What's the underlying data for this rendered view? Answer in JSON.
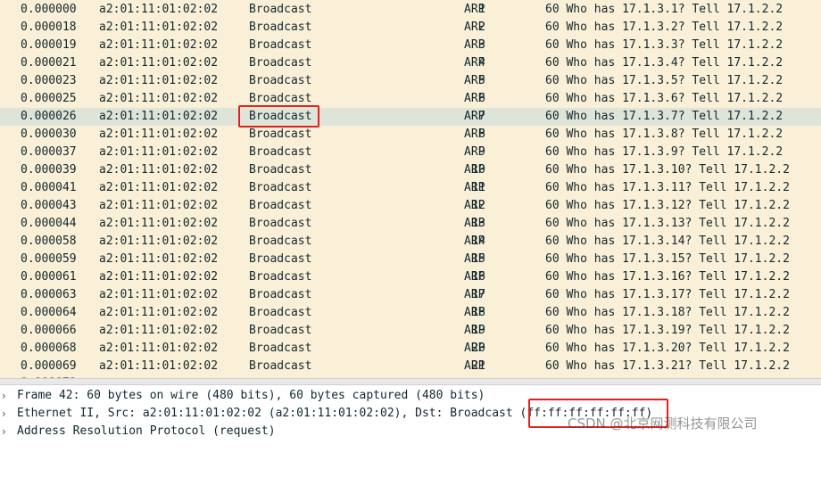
{
  "packet_list": {
    "rows": [
      {
        "time": "0.000000",
        "source": "a2:01:11:01:02:02",
        "destination": "Broadcast",
        "no": "1",
        "protocol": "ARP",
        "length": "60",
        "info": "Who has 17.1.3.1? Tell 17.1.2.2"
      },
      {
        "time": "0.000018",
        "source": "a2:01:11:01:02:02",
        "destination": "Broadcast",
        "no": "2",
        "protocol": "ARP",
        "length": "60",
        "info": "Who has 17.1.3.2? Tell 17.1.2.2"
      },
      {
        "time": "0.000019",
        "source": "a2:01:11:01:02:02",
        "destination": "Broadcast",
        "no": "3",
        "protocol": "ARP",
        "length": "60",
        "info": "Who has 17.1.3.3? Tell 17.1.2.2"
      },
      {
        "time": "0.000021",
        "source": "a2:01:11:01:02:02",
        "destination": "Broadcast",
        "no": "4",
        "protocol": "ARP",
        "length": "60",
        "info": "Who has 17.1.3.4? Tell 17.1.2.2"
      },
      {
        "time": "0.000023",
        "source": "a2:01:11:01:02:02",
        "destination": "Broadcast",
        "no": "5",
        "protocol": "ARP",
        "length": "60",
        "info": "Who has 17.1.3.5? Tell 17.1.2.2"
      },
      {
        "time": "0.000025",
        "source": "a2:01:11:01:02:02",
        "destination": "Broadcast",
        "no": "6",
        "protocol": "ARP",
        "length": "60",
        "info": "Who has 17.1.3.6? Tell 17.1.2.2"
      },
      {
        "time": "0.000026",
        "source": "a2:01:11:01:02:02",
        "destination": "Broadcast",
        "no": "7",
        "protocol": "ARP",
        "length": "60",
        "info": "Who has 17.1.3.7? Tell 17.1.2.2"
      },
      {
        "time": "0.000030",
        "source": "a2:01:11:01:02:02",
        "destination": "Broadcast",
        "no": "8",
        "protocol": "ARP",
        "length": "60",
        "info": "Who has 17.1.3.8? Tell 17.1.2.2"
      },
      {
        "time": "0.000037",
        "source": "a2:01:11:01:02:02",
        "destination": "Broadcast",
        "no": "9",
        "protocol": "ARP",
        "length": "60",
        "info": "Who has 17.1.3.9? Tell 17.1.2.2"
      },
      {
        "time": "0.000039",
        "source": "a2:01:11:01:02:02",
        "destination": "Broadcast",
        "no": "10",
        "protocol": "ARP",
        "length": "60",
        "info": "Who has 17.1.3.10? Tell 17.1.2.2"
      },
      {
        "time": "0.000041",
        "source": "a2:01:11:01:02:02",
        "destination": "Broadcast",
        "no": "11",
        "protocol": "ARP",
        "length": "60",
        "info": "Who has 17.1.3.11? Tell 17.1.2.2"
      },
      {
        "time": "0.000043",
        "source": "a2:01:11:01:02:02",
        "destination": "Broadcast",
        "no": "12",
        "protocol": "ARP",
        "length": "60",
        "info": "Who has 17.1.3.12? Tell 17.1.2.2"
      },
      {
        "time": "0.000044",
        "source": "a2:01:11:01:02:02",
        "destination": "Broadcast",
        "no": "13",
        "protocol": "ARP",
        "length": "60",
        "info": "Who has 17.1.3.13? Tell 17.1.2.2"
      },
      {
        "time": "0.000058",
        "source": "a2:01:11:01:02:02",
        "destination": "Broadcast",
        "no": "14",
        "protocol": "ARP",
        "length": "60",
        "info": "Who has 17.1.3.14? Tell 17.1.2.2"
      },
      {
        "time": "0.000059",
        "source": "a2:01:11:01:02:02",
        "destination": "Broadcast",
        "no": "15",
        "protocol": "ARP",
        "length": "60",
        "info": "Who has 17.1.3.15? Tell 17.1.2.2"
      },
      {
        "time": "0.000061",
        "source": "a2:01:11:01:02:02",
        "destination": "Broadcast",
        "no": "16",
        "protocol": "ARP",
        "length": "60",
        "info": "Who has 17.1.3.16? Tell 17.1.2.2"
      },
      {
        "time": "0.000063",
        "source": "a2:01:11:01:02:02",
        "destination": "Broadcast",
        "no": "17",
        "protocol": "ARP",
        "length": "60",
        "info": "Who has 17.1.3.17? Tell 17.1.2.2"
      },
      {
        "time": "0.000064",
        "source": "a2:01:11:01:02:02",
        "destination": "Broadcast",
        "no": "18",
        "protocol": "ARP",
        "length": "60",
        "info": "Who has 17.1.3.18? Tell 17.1.2.2"
      },
      {
        "time": "0.000066",
        "source": "a2:01:11:01:02:02",
        "destination": "Broadcast",
        "no": "19",
        "protocol": "ARP",
        "length": "60",
        "info": "Who has 17.1.3.19? Tell 17.1.2.2"
      },
      {
        "time": "0.000068",
        "source": "a2:01:11:01:02:02",
        "destination": "Broadcast",
        "no": "20",
        "protocol": "ARP",
        "length": "60",
        "info": "Who has 17.1.3.20? Tell 17.1.2.2"
      },
      {
        "time": "0.000069",
        "source": "a2:01:11:01:02:02",
        "destination": "Broadcast",
        "no": "21",
        "protocol": "ARP",
        "length": "60",
        "info": "Who has 17.1.3.21? Tell 17.1.2.2"
      }
    ],
    "selected_row": 6,
    "row_background": "#faf0d7",
    "selected_background": "#dfe4d9"
  },
  "details": {
    "lines": [
      {
        "arrow_icon": "chevron-right-icon",
        "text": "Frame 42: 60 bytes on wire (480 bits), 60 bytes captured (480 bits)"
      },
      {
        "arrow_icon": "chevron-right-icon",
        "text": "Ethernet II, Src: a2:01:11:01:02:02 (a2:01:11:01:02:02), Dst: Broadcast (ff:ff:ff:ff:ff:ff)"
      },
      {
        "arrow_icon": "chevron-right-icon",
        "text": "Address Resolution Protocol (request)"
      }
    ]
  },
  "annotations": {
    "color": "#e0221c"
  },
  "watermark": "CSDN @北京网测科技有限公司"
}
